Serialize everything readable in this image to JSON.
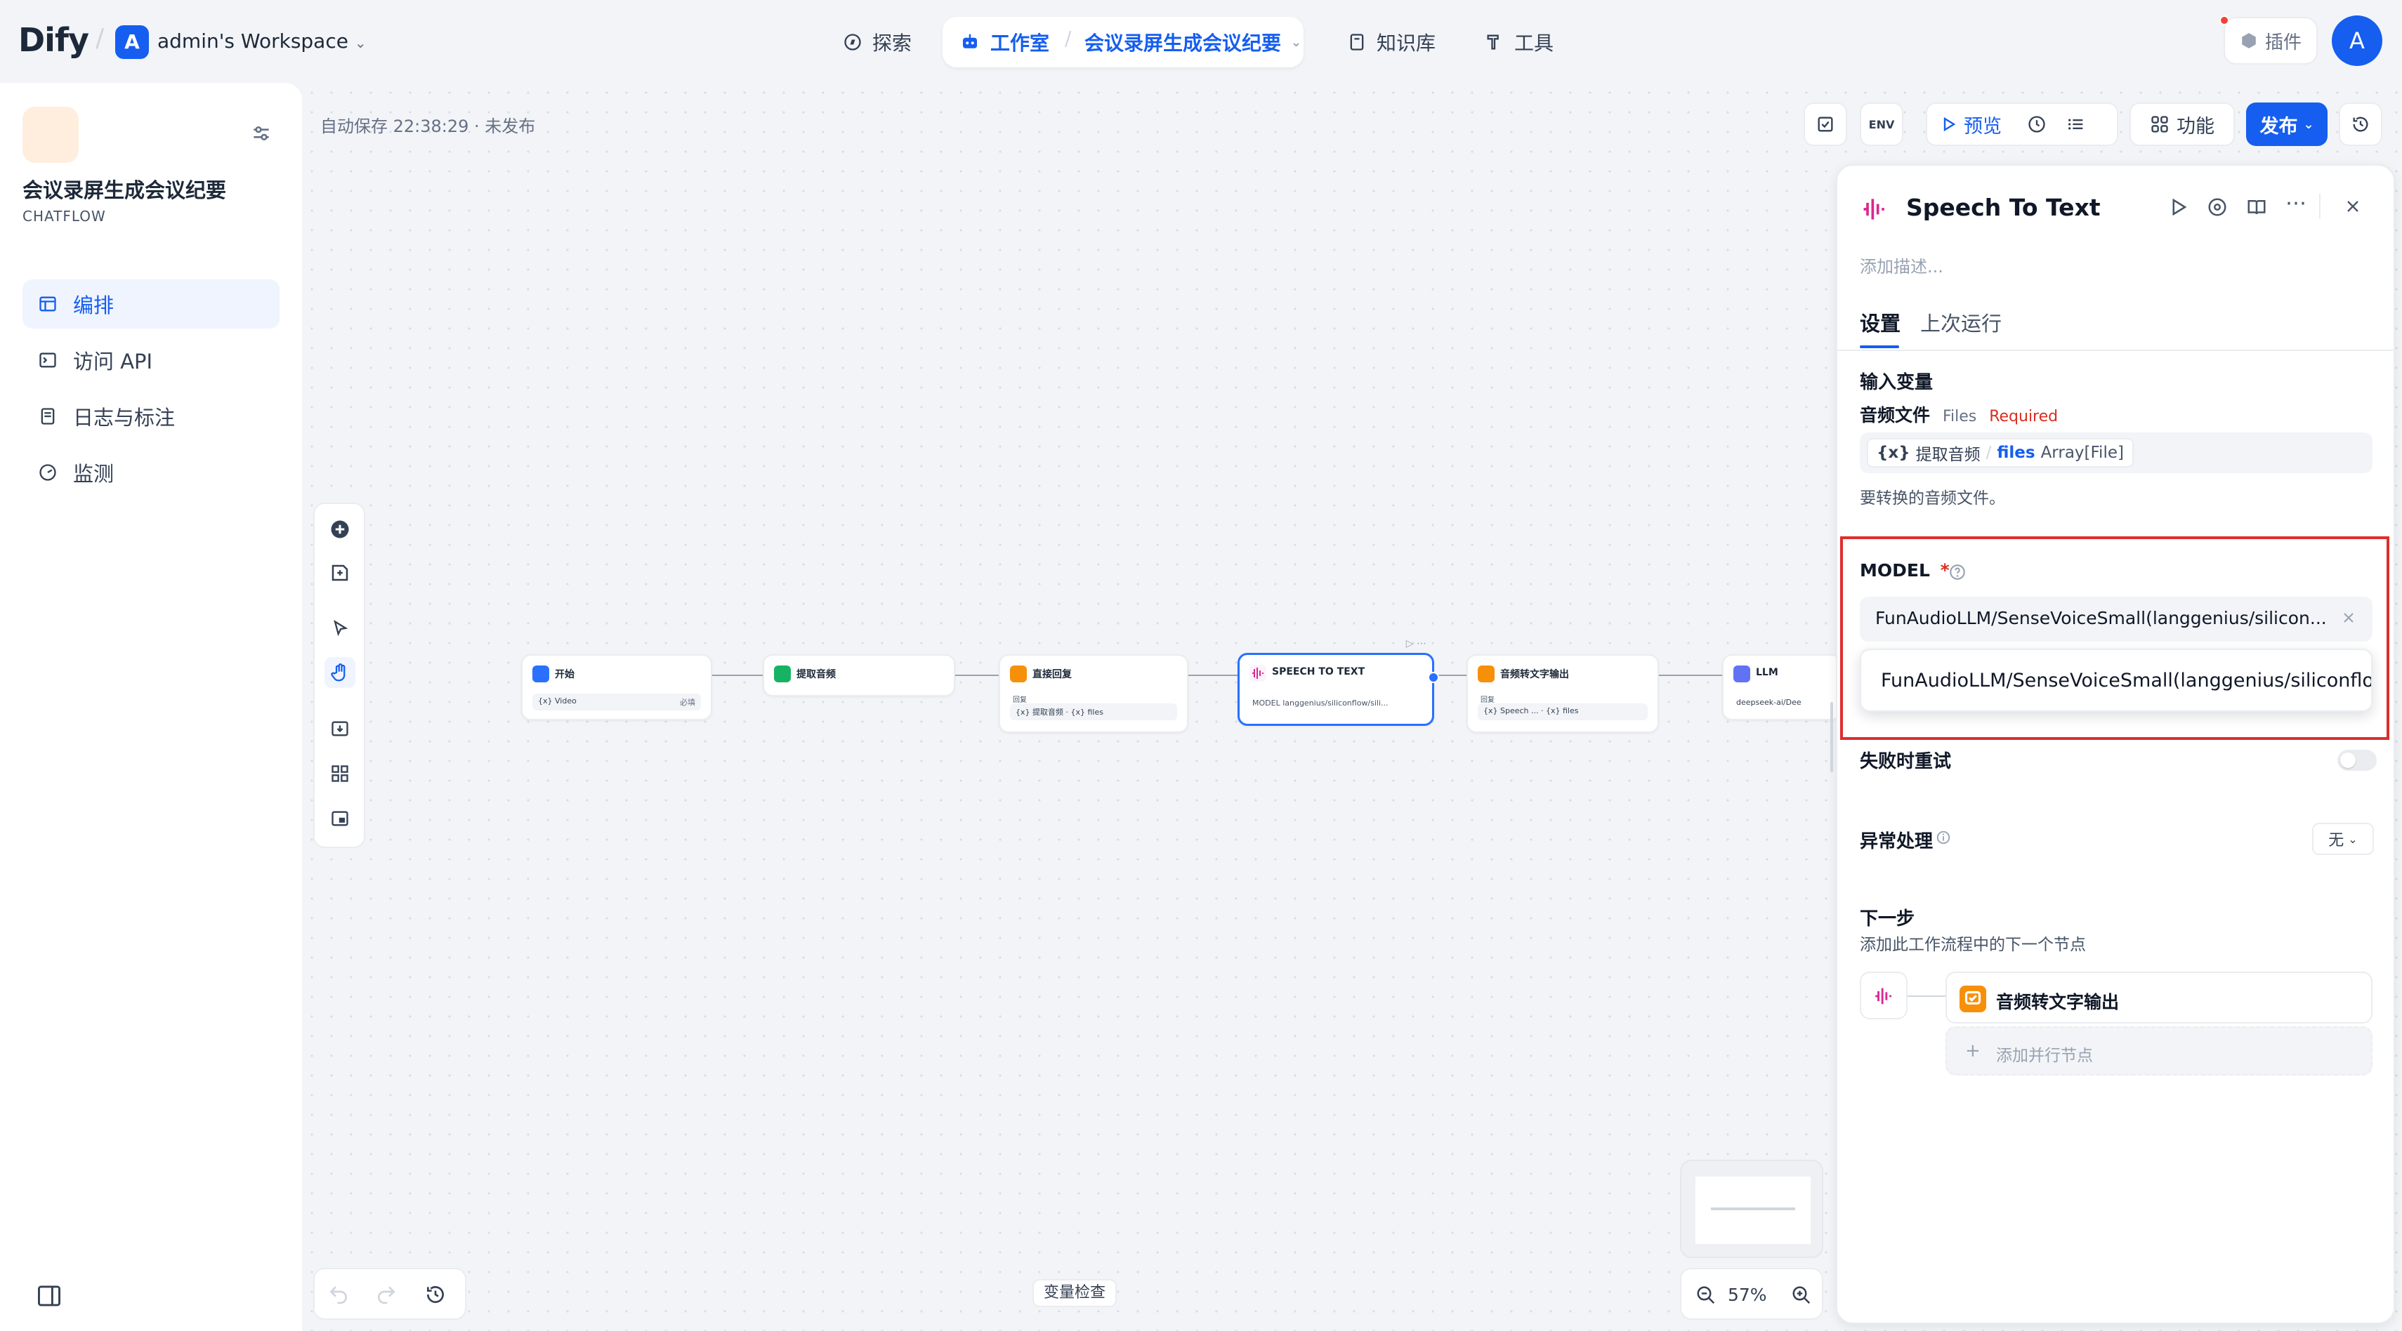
{
  "header": {
    "logo": "Dify",
    "workspace_initial": "A",
    "workspace_name": "admin's Workspace",
    "nav": {
      "explore": "探索",
      "studio": "工作室",
      "app_name": "会议录屏生成会议纪要",
      "knowledge": "知识库",
      "tools": "工具"
    },
    "plugins": "插件",
    "avatar": "A"
  },
  "sidebar": {
    "app_title": "会议录屏生成会议纪要",
    "app_type": "CHATFLOW",
    "items": [
      {
        "label": "编排",
        "icon": "layout-icon"
      },
      {
        "label": "访问 API",
        "icon": "terminal-icon"
      },
      {
        "label": "日志与标注",
        "icon": "log-icon"
      },
      {
        "label": "监测",
        "icon": "monitor-icon"
      }
    ]
  },
  "canvas": {
    "autosave": "自动保存 22:38:29 · 未发布",
    "toolbar": {
      "preview": "预览",
      "features": "功能",
      "publish": "发布",
      "env": "ENV"
    },
    "nodes": [
      {
        "title": "开始",
        "sub": "{x} Video",
        "tag": "必填"
      },
      {
        "title": "提取音频",
        "sub": ""
      },
      {
        "title": "直接回复",
        "label": "回复",
        "sub": "{x} 提取音频 · {x} files"
      },
      {
        "title": "SPEECH TO TEXT",
        "sub": "MODEL  langgenius/siliconflow/sili..."
      },
      {
        "title": "音频转文字输出",
        "label": "回复",
        "sub": "{x} Speech ... · {x} files"
      },
      {
        "title": "LLM",
        "sub": "deepseek-ai/Dee"
      }
    ],
    "variable_inspect": "变量检查",
    "zoom": "57%"
  },
  "panel": {
    "title": "Speech To Text",
    "description_placeholder": "添加描述...",
    "tabs": [
      "设置",
      "上次运行"
    ],
    "input_vars_label": "输入变量",
    "audio_file": {
      "label": "音频文件",
      "type": "Files",
      "required": "Required",
      "source_node": "提取音频",
      "var_name": "files",
      "var_type": "Array[File]",
      "hint": "要转换的音频文件。"
    },
    "model": {
      "label": "MODEL",
      "required_mark": "*",
      "value": "FunAudioLLM/SenseVoiceSmall(langgenius/silicon...",
      "option": "FunAudioLLM/SenseVoiceSmall(langgenius/siliconflow"
    },
    "retry_label": "失败时重试",
    "retry_enabled": false,
    "error_handling": {
      "label": "异常处理",
      "value": "无"
    },
    "next_step": {
      "label": "下一步",
      "description": "添加此工作流程中的下一个节点",
      "node": "音频转文字输出",
      "add_parallel": "添加并行节点"
    }
  },
  "colors": {
    "accent": "#155eef",
    "highlight": "#e02d2d",
    "required": "#d92d20"
  }
}
